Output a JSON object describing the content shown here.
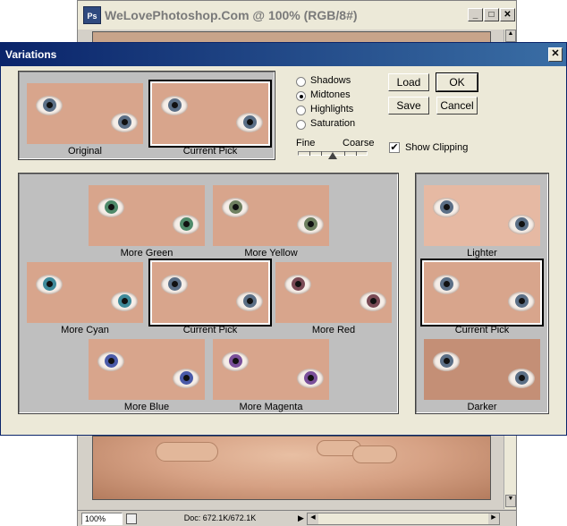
{
  "doc_window": {
    "title": "WeLovePhotoshop.Com @ 100% (RGB/8#)",
    "app_icon": "Ps",
    "minimize": "_",
    "maximize": "□",
    "close": "✕",
    "zoom": "100%",
    "doc_info": "Doc: 672.1K/672.1K"
  },
  "dialog": {
    "title": "Variations",
    "close": "✕",
    "original_label": "Original",
    "current_pick_label": "Current Pick",
    "options": {
      "shadows": "Shadows",
      "midtones": "Midtones",
      "highlights": "Highlights",
      "saturation": "Saturation",
      "selected": "Midtones"
    },
    "slider": {
      "fine": "Fine",
      "coarse": "Coarse",
      "value": 0.5
    },
    "show_clipping": {
      "label": "Show Clipping",
      "checked": true
    },
    "buttons": {
      "load": "Load",
      "ok": "OK",
      "save": "Save",
      "cancel": "Cancel"
    },
    "color_grid": {
      "more_green": "More Green",
      "more_yellow": "More Yellow",
      "more_cyan": "More Cyan",
      "current_pick": "Current Pick",
      "more_red": "More Red",
      "more_blue": "More Blue",
      "more_magenta": "More Magenta"
    },
    "brightness": {
      "lighter": "Lighter",
      "current_pick": "Current Pick",
      "darker": "Darker"
    },
    "colors": {
      "skin": "#d8a58c",
      "iris_default": "#5b6f86",
      "iris_green": "#4f8a6a",
      "iris_yellow": "#6f8060",
      "iris_cyan": "#3f8a9a",
      "iris_red": "#7a4a55",
      "iris_blue": "#4a5aa8",
      "iris_magenta": "#7a4f9a"
    }
  }
}
